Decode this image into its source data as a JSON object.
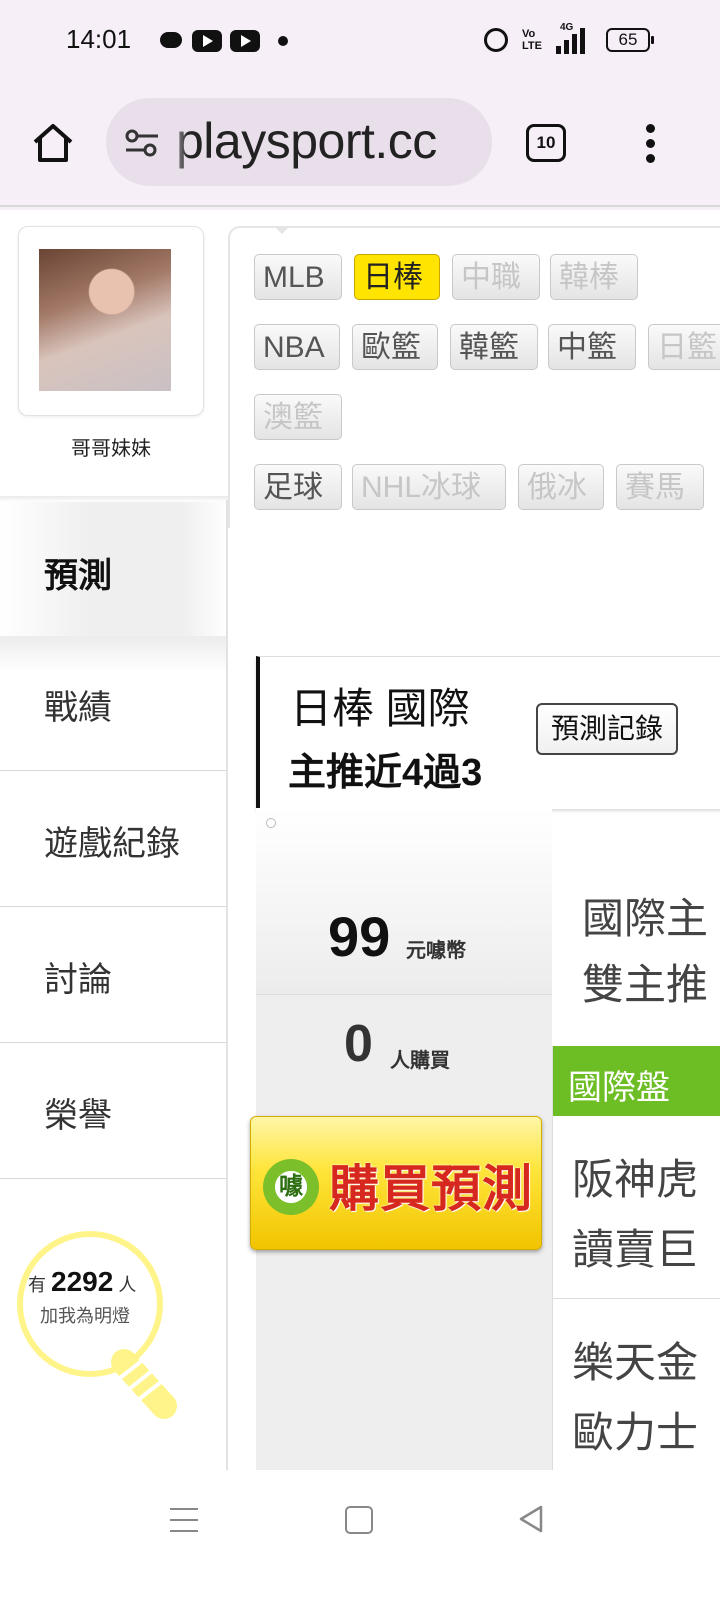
{
  "status_bar": {
    "time": "14:01",
    "battery": "65",
    "volte": "Vo LTE",
    "network": "4G",
    "icons": [
      "chat-icon",
      "youtube-icon",
      "youtube-icon",
      "notification-dot-icon",
      "alarm-icon",
      "volte-icon",
      "signal-icon",
      "battery-icon"
    ]
  },
  "browser": {
    "url": "playsport.cc",
    "tab_count": "10",
    "icons": [
      "home-icon",
      "site-settings-icon",
      "tabs-icon",
      "more-menu-icon"
    ]
  },
  "sidebar": {
    "username": "哥哥妹妹",
    "active": "預測",
    "items": [
      "戰績",
      "遊戲紀錄",
      "討論",
      "榮譽"
    ],
    "fans_prefix": "有",
    "fans_count": "2292",
    "fans_suffix": "人",
    "fans_caption": "加我為明燈"
  },
  "league_tabs": {
    "row1": [
      {
        "label": "MLB",
        "state": "normal"
      },
      {
        "label": "日棒",
        "state": "selected"
      },
      {
        "label": "中職",
        "state": "disabled"
      },
      {
        "label": "韓棒",
        "state": "disabled"
      }
    ],
    "row2": [
      {
        "label": "NBA",
        "state": "normal"
      },
      {
        "label": "歐籃",
        "state": "normal"
      },
      {
        "label": "韓籃",
        "state": "normal"
      },
      {
        "label": "中籃",
        "state": "normal"
      },
      {
        "label": "日籃",
        "state": "disabled"
      }
    ],
    "row3": [
      {
        "label": "澳籃",
        "state": "disabled"
      }
    ],
    "row4": [
      {
        "label": "足球",
        "state": "normal"
      },
      {
        "label": "NHL冰球",
        "state": "disabled"
      },
      {
        "label": "俄冰",
        "state": "disabled"
      },
      {
        "label": "賽馬",
        "state": "disabled"
      }
    ]
  },
  "record": {
    "title": "日棒 國際",
    "subtitle": "主推近4過3",
    "button": "預測記錄"
  },
  "price": {
    "value": "99",
    "unit": "元噱幣",
    "buyers": "0",
    "buyers_unit": "人購買",
    "buy_button": "購買預測",
    "coin_glyph": "噱"
  },
  "content": {
    "desc_line1": "國際主",
    "desc_line2": "雙主推",
    "pan_label": "國際盤",
    "games": [
      {
        "line1": "阪神虎",
        "line2": "讀賣巨"
      },
      {
        "line1": "樂天金",
        "line2": "歐力士"
      }
    ]
  },
  "colors": {
    "chrome_bg": "#f7eff8",
    "selected_tab": "#ffe400",
    "pan_green": "#6dbd24",
    "buy_red": "#d7281f"
  }
}
